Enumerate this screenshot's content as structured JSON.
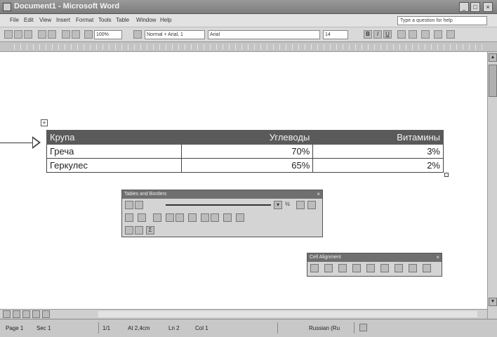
{
  "window": {
    "title": "Document1 - Microsoft Word",
    "controls": [
      "_",
      "□",
      "×"
    ]
  },
  "menu": {
    "items": [
      "File",
      "Edit",
      "View",
      "Insert",
      "Format",
      "Tools",
      "Table",
      "Window",
      "Help"
    ],
    "help_box": "Type a question for help"
  },
  "toolbar": {
    "zoom": "100%",
    "style": "Normal + Arial, 1",
    "font": "Arial",
    "size": "14",
    "bold": "B",
    "italic": "I",
    "underline": "U"
  },
  "table": {
    "header": [
      "Крупа",
      "Углеводы",
      "Витамины"
    ],
    "rows": [
      [
        "Греча",
        "70%",
        "3%"
      ],
      [
        "Геркулес",
        "65%",
        "2%"
      ]
    ]
  },
  "tables_and_borders": {
    "title": "Tables and Borders",
    "line_weight": "½"
  },
  "cell_alignment": {
    "title": "Cell Alignment"
  },
  "status": {
    "page": "Page 1",
    "section": "Sec 1",
    "pages": "1/1",
    "at": "At 2,4cm",
    "line": "Ln 2",
    "col": "Col 1",
    "language": "Russian (Ru"
  }
}
